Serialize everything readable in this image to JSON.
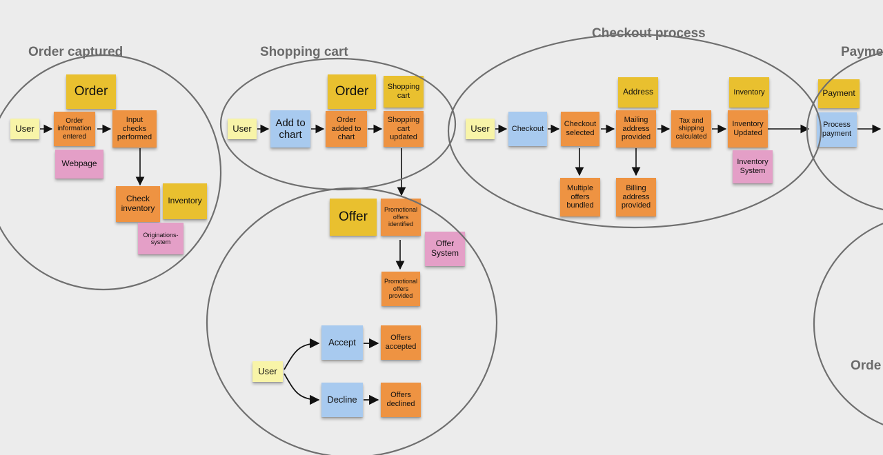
{
  "sections": {
    "order_captured": "Order captured",
    "shopping_cart": "Shopping cart",
    "checkout": "Checkout process",
    "payment": "Payme",
    "order2": "Orde"
  },
  "notes": {
    "oc_user": "User",
    "oc_order": "Order",
    "oc_order_info": "Order information entered",
    "oc_input_checks": "Input checks performed",
    "oc_webpage": "Webpage",
    "oc_check_inv": "Check inventory",
    "oc_inventory": "Inventory",
    "oc_origin": "Originations-system",
    "sc_user": "User",
    "sc_addtocart": "Add to chart",
    "sc_order": "Order",
    "sc_order_added": "Order added to chart",
    "sc_shopping_cart": "Shopping cart",
    "sc_cart_updated": "Shopping cart updated",
    "of_offer": "Offer",
    "of_promo_ident": "Promotional offers identified",
    "of_offer_system": "Offer System",
    "of_promo_prov": "Promotional offers provided",
    "of_user": "User",
    "of_accept": "Accept",
    "of_offers_accepted": "Offers accepted",
    "of_decline": "Decline",
    "of_offers_declined": "Offers declined",
    "ck_user": "User",
    "ck_checkout": "Checkout",
    "ck_checkout_sel": "Checkout selected",
    "ck_address": "Address",
    "ck_mailing": "Mailing address provided",
    "ck_multiple": "Multiple offers bundled",
    "ck_billing": "Billing address provided",
    "ck_tax": "Tax and shipping calculated",
    "ck_inventory": "Inventory",
    "ck_inv_updated": "Inventory Updated",
    "ck_inv_system": "Inventory System",
    "pm_payment": "Payment",
    "pm_process": "Process payment"
  }
}
